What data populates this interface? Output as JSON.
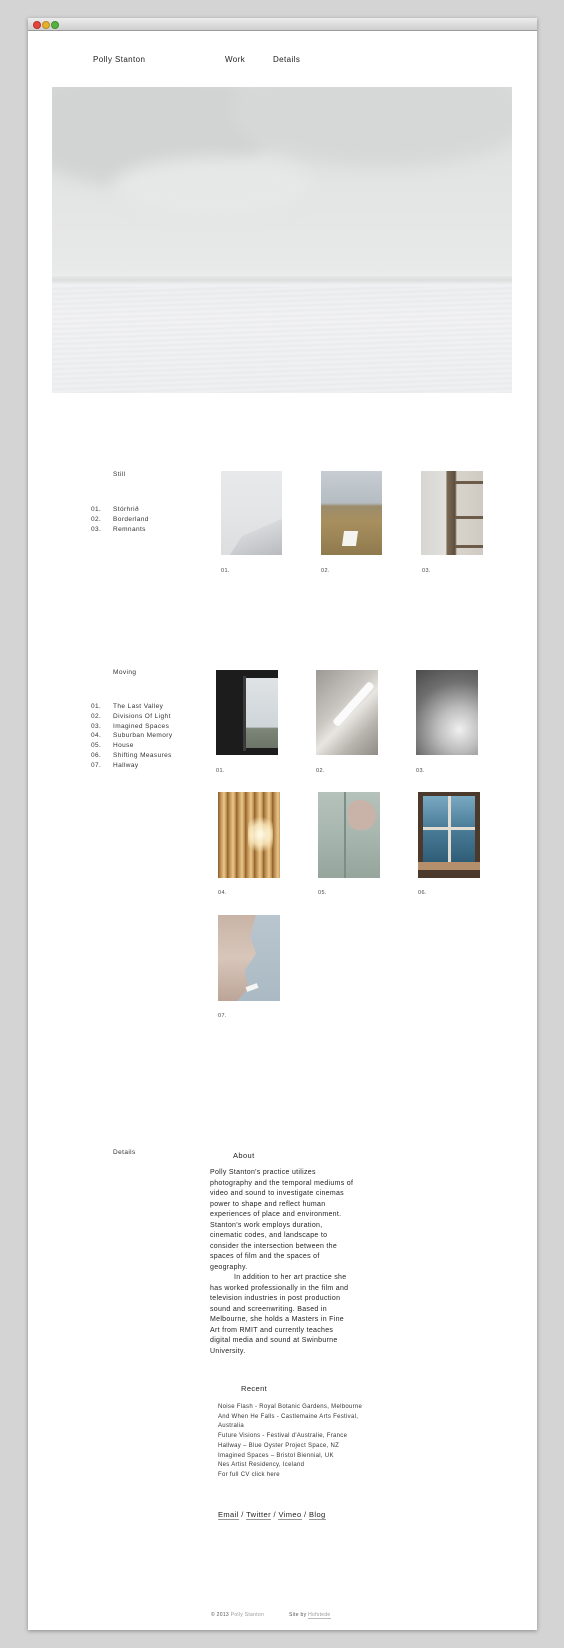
{
  "site": {
    "name": "Polly Stanton"
  },
  "nav": {
    "work": "Work",
    "details": "Details"
  },
  "still": {
    "title": "Still",
    "items": [
      {
        "num": "01.",
        "label": "Stórhrið"
      },
      {
        "num": "02.",
        "label": "Borderland"
      },
      {
        "num": "03.",
        "label": "Remnants"
      }
    ],
    "thumbs": [
      "01.",
      "02.",
      "03."
    ]
  },
  "moving": {
    "title": "Moving",
    "items": [
      {
        "num": "01.",
        "label": "The Last Valley"
      },
      {
        "num": "02.",
        "label": "Divisions Of Light"
      },
      {
        "num": "03.",
        "label": "Imagined Spaces"
      },
      {
        "num": "04.",
        "label": "Suburban Memory"
      },
      {
        "num": "05.",
        "label": "House"
      },
      {
        "num": "06.",
        "label": "Shifting Measures"
      },
      {
        "num": "07.",
        "label": "Hallway"
      }
    ],
    "thumbs": [
      "01.",
      "02.",
      "03.",
      "04.",
      "05.",
      "06.",
      "07."
    ]
  },
  "details": {
    "title": "Details",
    "about_heading": "About",
    "about_p1": "Polly Stanton's practice utilizes photography and the temporal mediums of video and sound to investigate cinemas power to shape and reflect human experiences of place and environment. Stanton's work employs duration, cinematic codes, and landscape to consider the intersection between the spaces of film and the spaces of geography.",
    "about_p2": "In addition to her art practice she has worked professionally in the film and television industries in post production sound and screenwriting. Based in Melbourne, she holds a Masters in Fine Art from RMIT and currently teaches digital media and sound at Swinburne University.",
    "recent_heading": "Recent",
    "recent": [
      "Noise Flash - Royal Botanic Gardens, Melbourne",
      "And When He Falls - Castlemaine Arts Festival, Australia",
      "Future Visions - Festival d'Australie, France",
      "Hallway – Blue Oyster Project Space, NZ",
      "Imagined Spaces – Bristol Biennial, UK",
      "Nes Artist Residency, Iceland",
      "For full CV click here"
    ],
    "links": {
      "email": "Email",
      "twitter": "Twitter",
      "vimeo": "Vimeo",
      "blog": "Blog",
      "sep": "/"
    }
  },
  "footer": {
    "copyright": "© 2013",
    "name": "Polly Stanton",
    "site_by": "Site by",
    "studio": "Hofstede"
  }
}
